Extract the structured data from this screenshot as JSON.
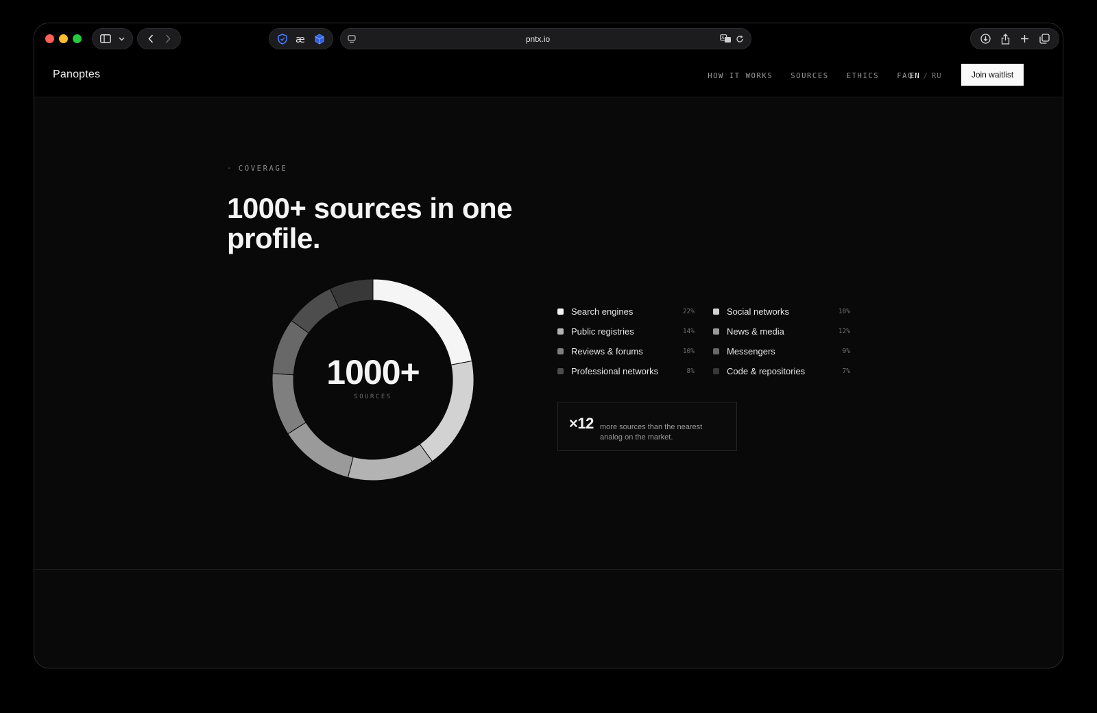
{
  "browser": {
    "url": "pntx.io"
  },
  "header": {
    "logo": "Panoptes",
    "nav": [
      "HOW IT WORKS",
      "SOURCES",
      "ETHICS",
      "FAQ"
    ],
    "lang_active": "EN",
    "lang_separator": "/",
    "lang_inactive": "RU",
    "cta_label": "Join waitlist"
  },
  "hero": {
    "eyebrow_dot": "·",
    "eyebrow": "COVERAGE",
    "title": "1000+ sources in one profile."
  },
  "chart_data": {
    "type": "pie",
    "center_value": "1000+",
    "center_label": "SOURCES",
    "categories": [
      "Search engines",
      "Social networks",
      "Public registries",
      "News & media",
      "Reviews & forums",
      "Messengers",
      "Professional networks",
      "Code & repositories"
    ],
    "values": [
      22,
      18,
      14,
      12,
      10,
      9,
      8,
      7
    ],
    "labels": [
      "22%",
      "18%",
      "14%",
      "12%",
      "10%",
      "9%",
      "8%",
      "7%"
    ],
    "colors": [
      "#f5f5f5",
      "#d2d2d2",
      "#b3b3b3",
      "#9a9a9a",
      "#7f7f7f",
      "#686868",
      "#4d4d4d",
      "#383838"
    ]
  },
  "stat": {
    "value": "×12",
    "text": "more sources than the nearest analog on the market."
  }
}
